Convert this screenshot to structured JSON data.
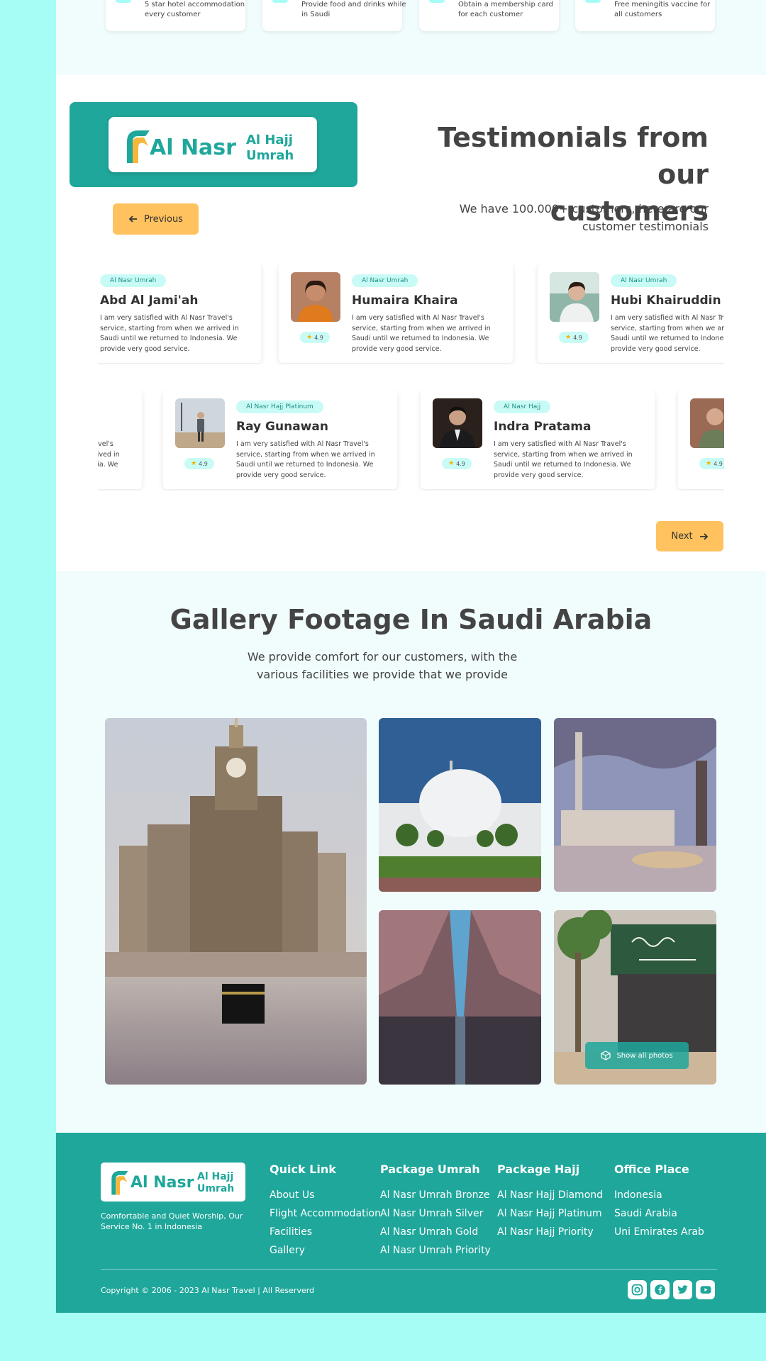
{
  "features": [
    {
      "text": "5 star hotel accommodation every customer"
    },
    {
      "text": "Provide food and drinks while in Saudi"
    },
    {
      "text": "Obtain a membership card for each customer"
    },
    {
      "text": "Free meningitis vaccine for all customers"
    }
  ],
  "brand": {
    "name": "Al Nasr",
    "sub1": "Al Hajj",
    "sub2": "Umrah"
  },
  "testimonials": {
    "title_line1": "Testimonials from our",
    "title_line2": "customers",
    "subtitle": "We have 100.000+ customers, here are our customer testimonials",
    "prev_label": "Previous",
    "next_label": "Next",
    "row1": [
      {
        "badge": "Al Nasr Umrah",
        "name": "Abd Al Jami'ah",
        "quote": "I am very satisfied with Al Nasr Travel's service, starting from when we arrived in Saudi until we returned to Indonesia. We provide very good service.",
        "rating": ""
      },
      {
        "badge": "Al Nasr Umrah",
        "name": "Humaira Khaira",
        "quote": "I am very satisfied with Al Nasr Travel's service, starting from when we arrived in Saudi until we returned to Indonesia. We provide very good service.",
        "rating": "4.9"
      },
      {
        "badge": "Al Nasr Umrah",
        "name": "Hubi Khairuddin",
        "quote": "I am very satisfied with Al Nasr Travel's service, starting from when we arrived in Saudi until we returned to Indonesia. We provide very good service.",
        "rating": "4.9"
      }
    ],
    "row2": [
      {
        "badge": "",
        "name": "",
        "quote": "I am very satisfied with Al Nasr Travel's service, starting from when we arrived in Saudi until we returned to Indonesia. We provide very good service.",
        "rating": ""
      },
      {
        "badge": "Al Nasr Hajj Platinum",
        "name": "Ray Gunawan",
        "quote": "I am very satisfied with Al Nasr Travel's service, starting from when we arrived in Saudi until we returned to Indonesia. We provide very good service.",
        "rating": "4.9"
      },
      {
        "badge": "Al Nasr Hajj",
        "name": "Indra Pratama",
        "quote": "I am very satisfied with Al Nasr Travel's service, starting from when we arrived in Saudi until we returned to Indonesia. We provide very good service.",
        "rating": "4.9"
      },
      {
        "badge": "",
        "name": "",
        "quote": "",
        "rating": "4.9"
      }
    ]
  },
  "gallery": {
    "title": "Gallery Footage In Saudi Arabia",
    "subtitle": "We provide comfort for our customers, with the various facilities we provide that we provide",
    "show_all_label": "Show all photos"
  },
  "footer": {
    "tagline": "Comfortable and Quiet Worship, Our Service No. 1 in Indonesia",
    "quick_link": {
      "title": "Quick Link",
      "links": [
        "About Us",
        "Flight Accommodation",
        "Facilities",
        "Gallery"
      ]
    },
    "package_umrah": {
      "title": "Package Umrah",
      "links": [
        "Al Nasr Umrah Bronze",
        "Al Nasr Umrah Silver",
        "Al Nasr Umrah Gold",
        "Al Nasr Umrah Priority"
      ]
    },
    "package_hajj": {
      "title": "Package Hajj",
      "links": [
        "Al Nasr Hajj Diamond",
        "Al Nasr Hajj Platinum",
        "Al Nasr Hajj Priority"
      ]
    },
    "office": {
      "title": "Office Place",
      "links": [
        "Indonesia",
        "Saudi Arabia",
        "Uni Emirates Arab"
      ]
    },
    "copyright": "Copyright © 2006 - 2023 Al Nasr Travel | All Reserverd",
    "social": [
      "instagram-icon",
      "facebook-icon",
      "twitter-icon",
      "youtube-icon"
    ]
  },
  "colors": {
    "teal": "#1fa79b",
    "accent": "#ffc25e",
    "mint": "#a6fdf5",
    "badge": "#c9fbf6"
  }
}
